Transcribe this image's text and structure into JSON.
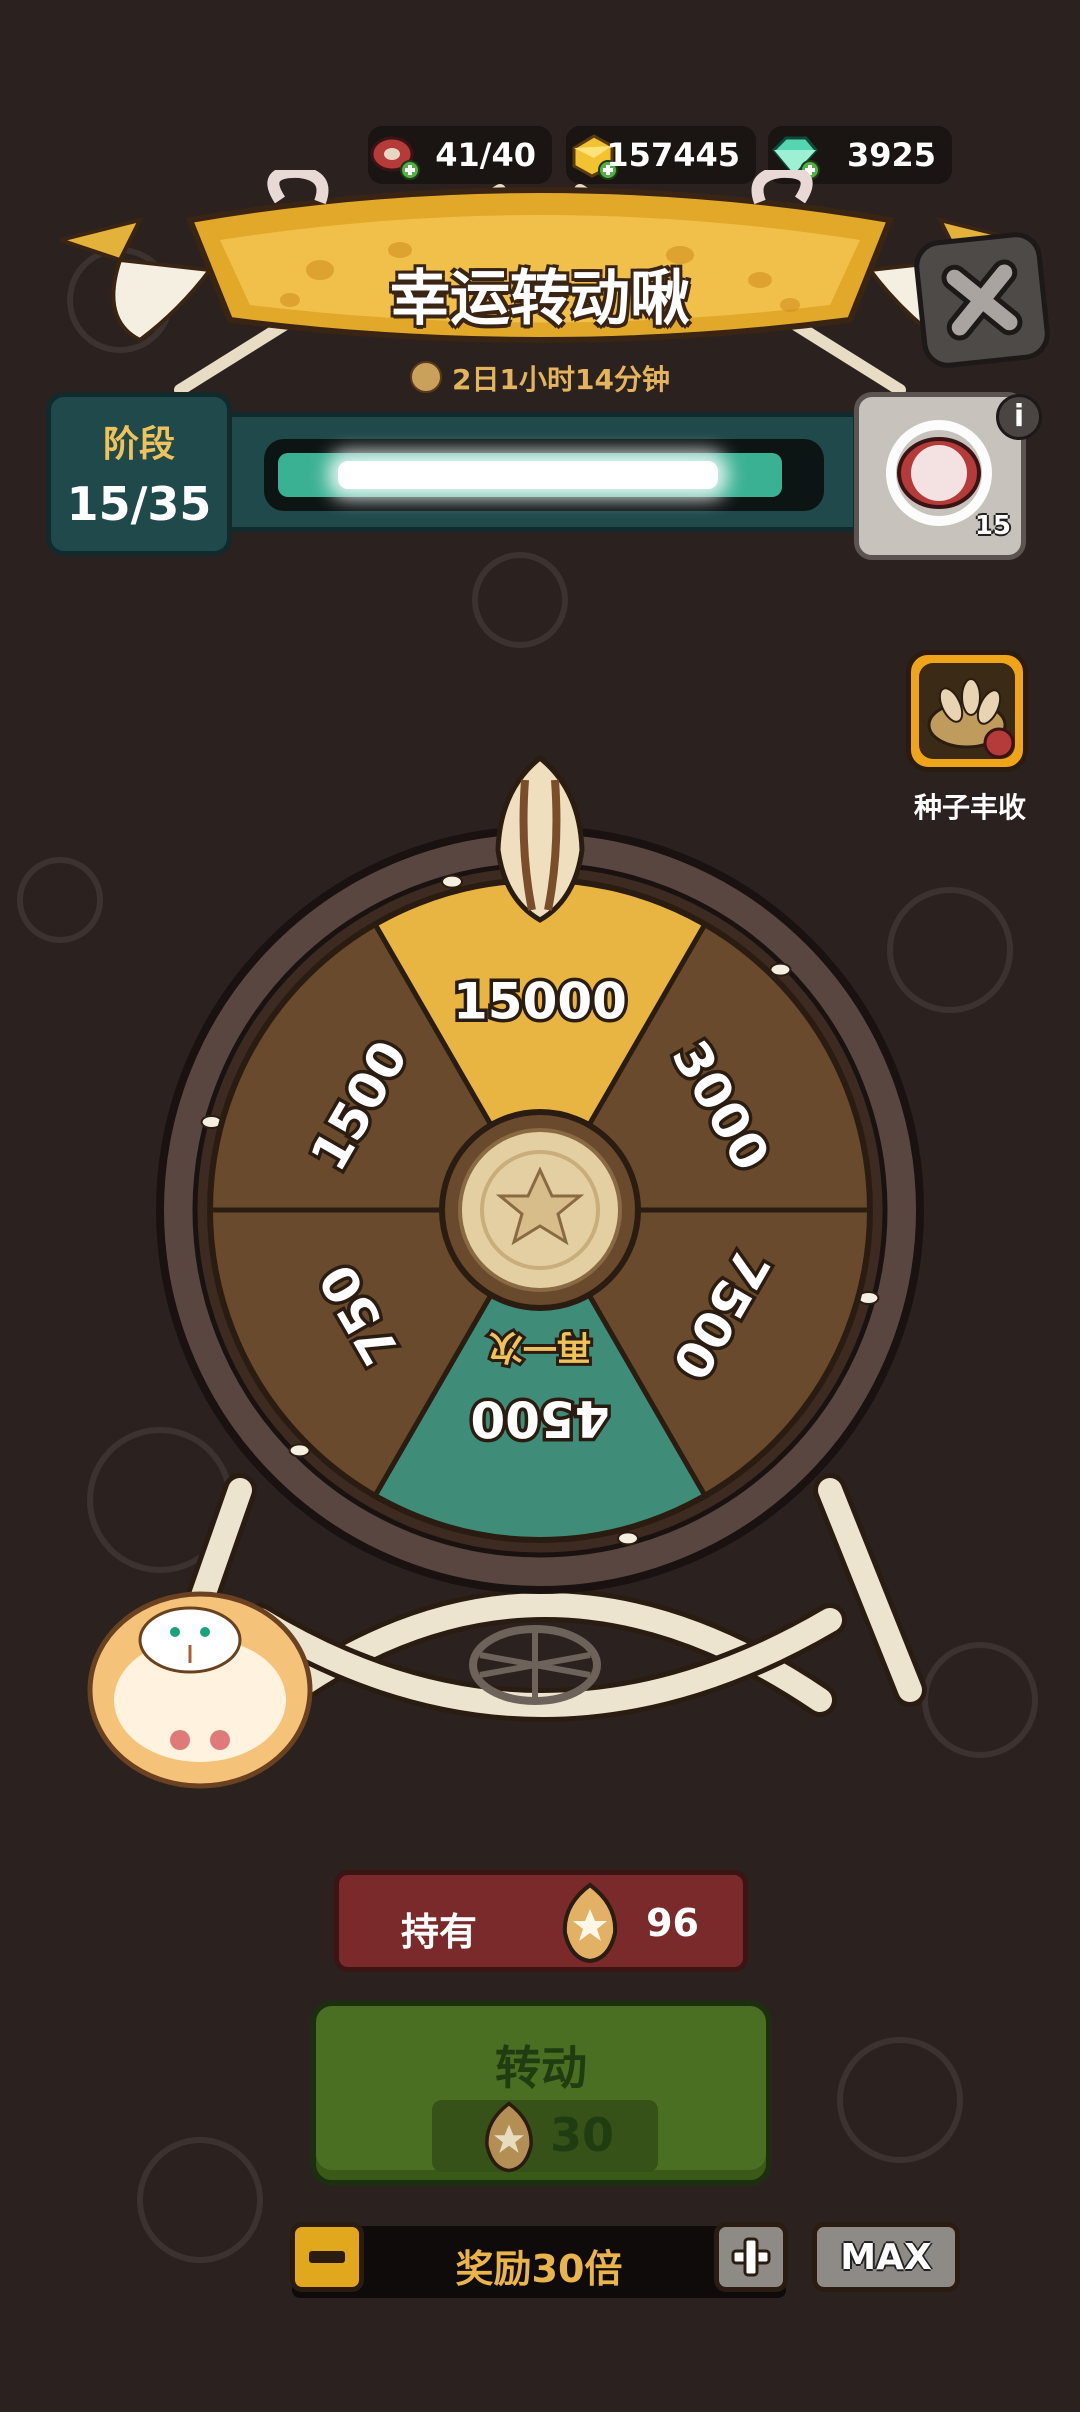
{
  "currencies": [
    {
      "name": "meat",
      "value": "41/40"
    },
    {
      "name": "gold",
      "value": "157445"
    },
    {
      "name": "gem",
      "value": "3925"
    }
  ],
  "title": "幸运转动啾",
  "timer": "2日1小时14分钟",
  "stage": {
    "label": "阶段",
    "value": "15/35",
    "progress": 0.95
  },
  "stage_reward": {
    "count": "15"
  },
  "side_event": {
    "label": "种子丰收"
  },
  "info_label": "i",
  "wheel": {
    "segments": [
      {
        "value": "15000",
        "color": "#e8b543"
      },
      {
        "value": "3000",
        "color": "#6a4a2c"
      },
      {
        "value": "7500",
        "color": "#6a4a2c"
      },
      {
        "value": "4500",
        "color": "#3f8c78",
        "tag": "再一次"
      },
      {
        "value": "750",
        "color": "#6a4a2c"
      },
      {
        "value": "1500",
        "color": "#6a4a2c"
      }
    ]
  },
  "held": {
    "label": "持有",
    "count": "96"
  },
  "spin": {
    "label": "转动",
    "cost": "30"
  },
  "multiplier": {
    "label": "奖励30倍",
    "minus": "−",
    "plus": "+",
    "max": "MAX"
  },
  "colors": {
    "background": "#2b211f",
    "accent_gold": "#e9b44a",
    "teal": "#20494b"
  }
}
